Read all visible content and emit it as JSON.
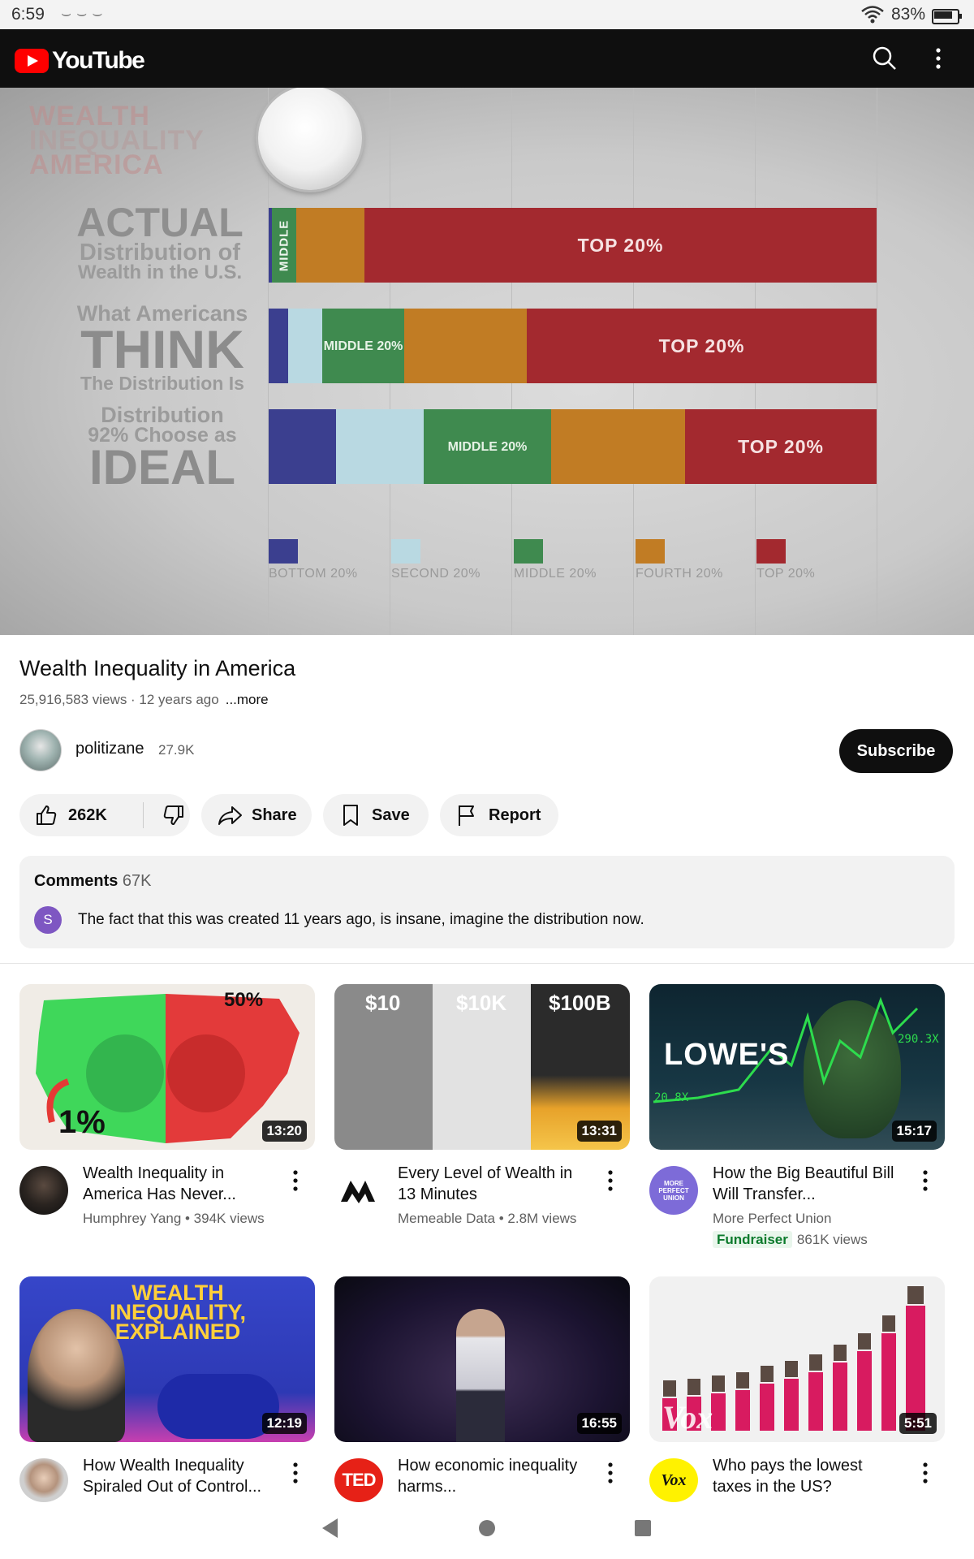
{
  "status_bar": {
    "time": "6:59",
    "notifications": "⌣⌣⌣",
    "battery": "83%"
  },
  "app": {
    "name": "YouTube"
  },
  "video_frame": {
    "watermark": [
      "WEALTH",
      "INEQUALITY",
      "AMERICA"
    ],
    "rows": [
      {
        "label": [
          "ACTUAL",
          "Distribution of",
          "Wealth in the U.S."
        ],
        "middle_label": "MIDDLE",
        "top_label": "TOP 20%"
      },
      {
        "label": [
          "What Americans",
          "THINK",
          "The Distribution Is"
        ],
        "middle_label": "MIDDLE 20%",
        "top_label": "TOP 20%"
      },
      {
        "label": [
          "Distribution",
          "92% Choose as",
          "IDEAL"
        ],
        "middle_label": "MIDDLE 20%",
        "top_label": "TOP 20%"
      }
    ],
    "legend": [
      "BOTTOM 20%",
      "SECOND 20%",
      "MIDDLE 20%",
      "FOURTH 20%",
      "TOP 20%"
    ],
    "colors": {
      "bottom": "#3b3f8f",
      "second": "#b9d9e2",
      "middle": "#3f8a4f",
      "fourth": "#c17c24",
      "top": "#a3292f"
    }
  },
  "video": {
    "title": "Wealth Inequality in America",
    "meta": "25,916,583 views · 12 years ago",
    "more": "...more",
    "channel": "politizane",
    "subscribers": "27.9K",
    "subscribe_label": "Subscribe"
  },
  "actions": {
    "likes": "262K",
    "share": "Share",
    "save": "Save",
    "report": "Report"
  },
  "comments": {
    "heading": "Comments",
    "count": "67K",
    "avatar_letter": "S",
    "top_comment": "The fact that this was created 11 years ago, is insane, imagine the distribution now."
  },
  "recommendations": [
    {
      "title": "Wealth Inequality in America Has Never...",
      "channel": "Humphrey Yang",
      "meta": "Humphrey Yang • 394K views",
      "duration": "13:20",
      "thumb_text": [
        "50%",
        "1%"
      ]
    },
    {
      "title": "Every Level of Wealth in 13 Minutes",
      "channel": "Memeable Data",
      "meta": "Memeable Data • 2.8M views",
      "duration": "13:31",
      "thumb_text": [
        "$10",
        "$10K",
        "$100B"
      ]
    },
    {
      "title": "How the Big Beautiful Bill Will Transfer...",
      "channel": "More Perfect Union",
      "meta": "More Perfect Union",
      "badge": "Fundraiser",
      "views": "861K views",
      "duration": "15:17",
      "thumb_text": [
        "LOWE'S",
        "290.3X",
        "20.8X"
      ],
      "avatar_text": "MORE PERFECT UNION"
    },
    {
      "title": "How Wealth Inequality Spiraled Out of Control...",
      "duration": "12:19",
      "thumb_text": [
        "WEALTH",
        "INEQUALITY,",
        "EXPLAINED"
      ]
    },
    {
      "title": "How economic inequality harms...",
      "duration": "16:55",
      "avatar_text": "TED"
    },
    {
      "title": "Who pays the lowest taxes in the US?",
      "duration": "5:51",
      "avatar_text": "Vox",
      "thumb_text": [
        "Vox"
      ]
    }
  ]
}
